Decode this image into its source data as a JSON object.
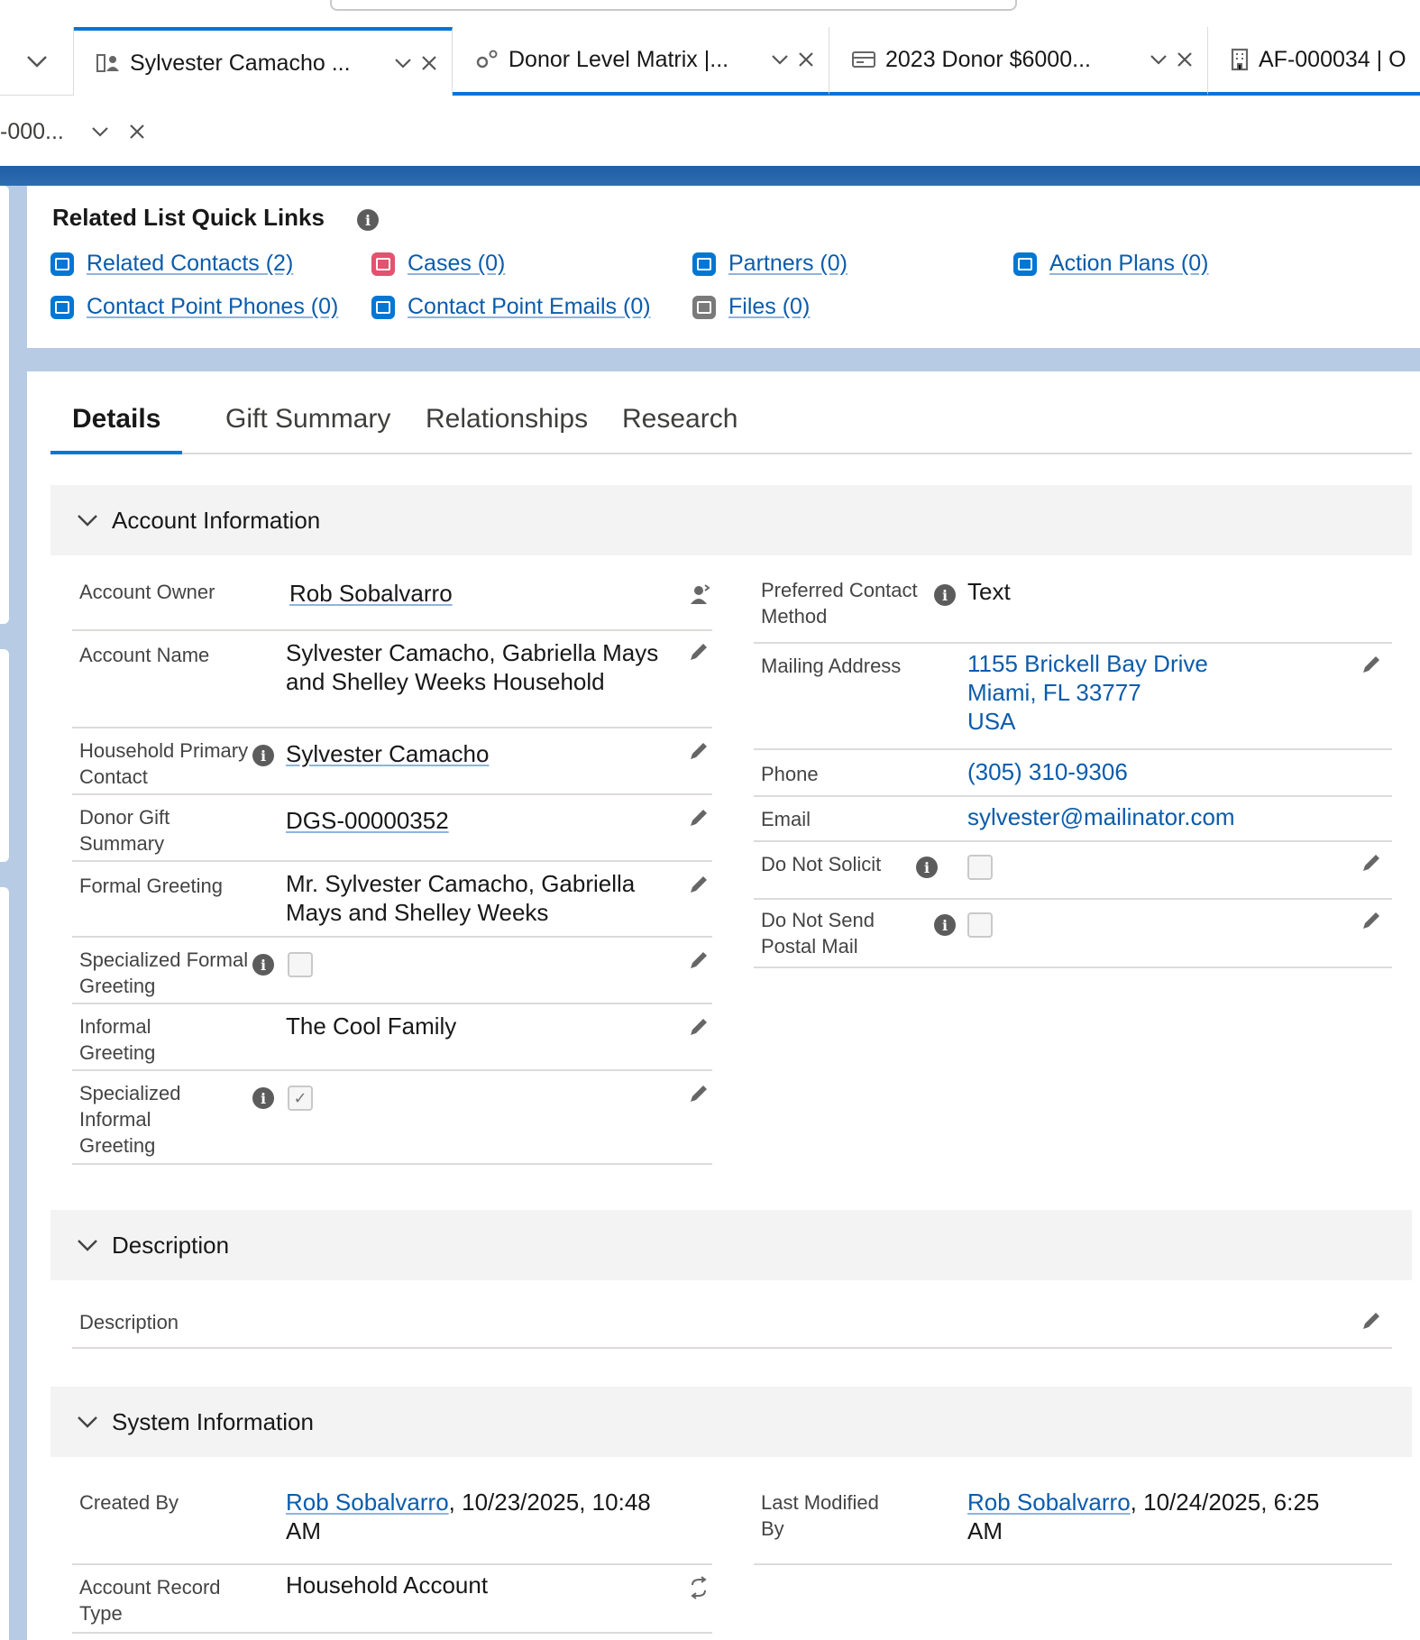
{
  "workspace_tabs": [
    {
      "title": "Sylvester Camacho ...",
      "icon": "household-icon"
    },
    {
      "title": "Donor Level Matrix |...",
      "icon": "settings-gears-icon"
    },
    {
      "title": "2023 Donor $6000...",
      "icon": "summary-card-icon"
    },
    {
      "title": "AF-000034 | O",
      "icon": "building-icon"
    }
  ],
  "subtab": {
    "title": "-000..."
  },
  "quick_links": {
    "title": "Related List Quick Links",
    "links": [
      {
        "label": "Related Contacts (2)",
        "icon": "contacts-icon",
        "color": "#0176d3"
      },
      {
        "label": "Cases (0)",
        "icon": "case-icon",
        "color": "#e3526f"
      },
      {
        "label": "Partners (0)",
        "icon": "partners-icon",
        "color": "#0176d3"
      },
      {
        "label": "Action Plans (0)",
        "icon": "action-plans-icon",
        "color": "#0176d3"
      },
      {
        "label": "Contact Point Phones (0)",
        "icon": "phone-icon",
        "color": "#0176d3"
      },
      {
        "label": "Contact Point Emails (0)",
        "icon": "email-icon",
        "color": "#0176d3"
      },
      {
        "label": "Files (0)",
        "icon": "files-icon",
        "color": "#7a7a7a"
      }
    ]
  },
  "detail_tabs": [
    "Details",
    "Gift Summary",
    "Relationships",
    "Research"
  ],
  "sections": {
    "account_information": "Account Information",
    "description": "Description",
    "system_information": "System Information"
  },
  "account_fields": {
    "account_owner": {
      "label": "Account Owner",
      "value": "Rob Sobalvarro"
    },
    "account_name": {
      "label": "Account Name",
      "value": "Sylvester Camacho, Gabriella Mays and Shelley Weeks Household"
    },
    "household_primary_contact": {
      "label": "Household Primary Contact",
      "value": "Sylvester Camacho"
    },
    "donor_gift_summary": {
      "label": "Donor Gift Summary",
      "value": "DGS-00000352"
    },
    "formal_greeting": {
      "label": "Formal Greeting",
      "value": "Mr. Sylvester Camacho, Gabriella Mays and Shelley Weeks"
    },
    "specialized_formal_greeting": {
      "label": "Specialized Formal Greeting",
      "checked": false
    },
    "informal_greeting": {
      "label": "Informal Greeting",
      "value": "The Cool Family"
    },
    "specialized_informal_greeting": {
      "label": "Specialized Informal Greeting",
      "checked": true
    },
    "preferred_contact_method": {
      "label": "Preferred Contact Method",
      "value": "Text"
    },
    "mailing_address": {
      "label": "Mailing Address",
      "line1": "1155 Brickell Bay Drive",
      "line2": "Miami, FL 33777",
      "line3": "USA"
    },
    "phone": {
      "label": "Phone",
      "value": "(305) 310-9306"
    },
    "email": {
      "label": "Email",
      "value": "sylvester@mailinator.com"
    },
    "do_not_solicit": {
      "label": "Do Not Solicit",
      "checked": false
    },
    "do_not_send_postal_mail": {
      "label": "Do Not Send Postal Mail",
      "checked": false
    }
  },
  "description_field": {
    "label": "Description",
    "value": ""
  },
  "system_fields": {
    "created_by": {
      "label": "Created By",
      "user": "Rob Sobalvarro",
      "date": ", 10/23/2025, 10:48 AM"
    },
    "last_modified_by": {
      "label": "Last Modified By",
      "user": "Rob Sobalvarro",
      "date": ", 10/24/2025, 6:25 AM"
    },
    "account_record_type": {
      "label": "Account Record Type",
      "value": "Household Account"
    }
  }
}
